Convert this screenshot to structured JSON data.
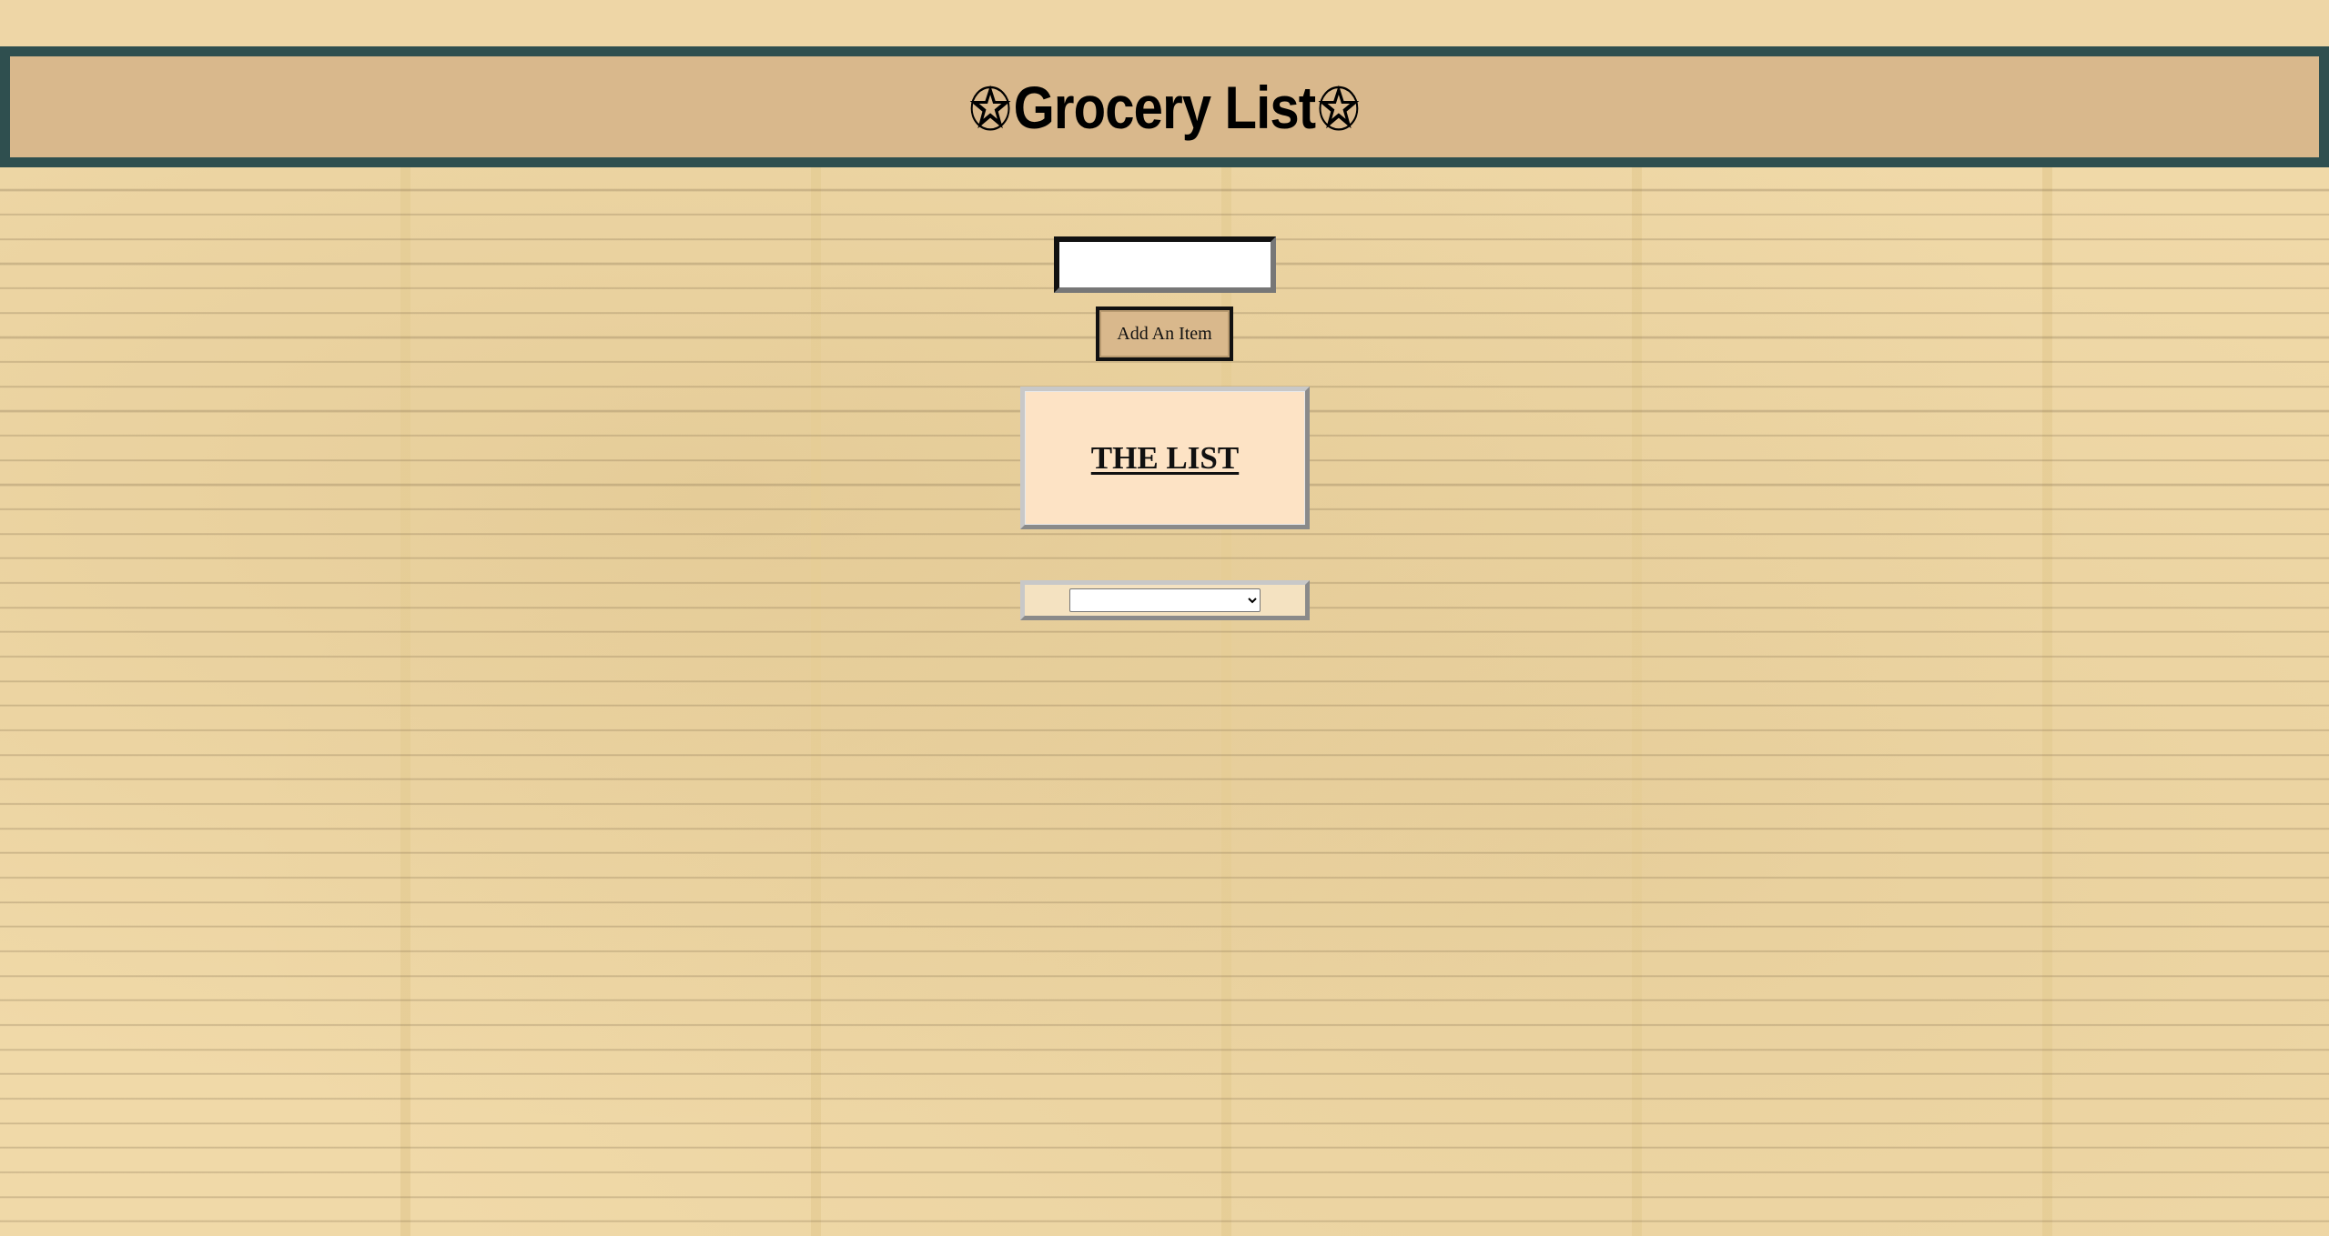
{
  "header": {
    "star_left": "✮",
    "title": "Grocery List",
    "star_right": "✮"
  },
  "form": {
    "input_value": "",
    "input_placeholder": "",
    "add_button_label": "Add An Item"
  },
  "list": {
    "title": "THE LIST",
    "items": []
  },
  "select": {
    "selected_value": ""
  },
  "colors": {
    "header_background": "#d9b88c",
    "header_border": "#2f4f4f",
    "list_background": "#fde3c5",
    "page_paper": "#f0d9a8"
  }
}
